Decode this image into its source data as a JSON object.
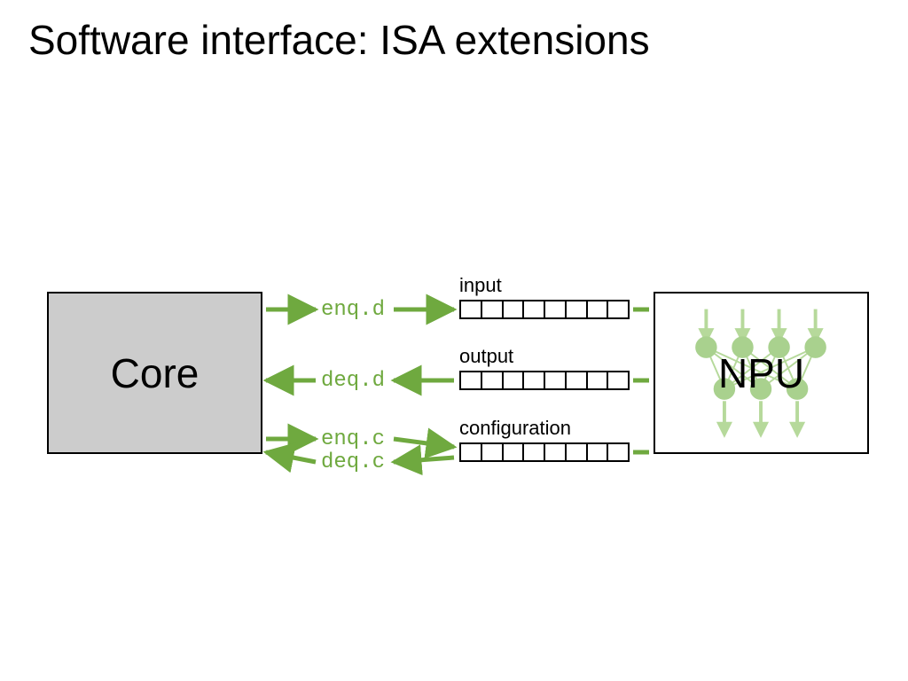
{
  "title": "Software interface: ISA extensions",
  "core": {
    "label": "Core"
  },
  "npu": {
    "label": "NPU"
  },
  "buffers": {
    "input": {
      "caption": "input",
      "cells": 8
    },
    "output": {
      "caption": "output",
      "cells": 8
    },
    "config": {
      "caption": "configuration",
      "cells": 8
    }
  },
  "instructions": {
    "enq_d": "enq.d",
    "deq_d": "deq.d",
    "enq_c": "enq.c",
    "deq_c": "deq.c"
  },
  "colors": {
    "accent": "#6fa93f",
    "accent_light": "#b6d99b",
    "core_fill": "#cccccc"
  }
}
